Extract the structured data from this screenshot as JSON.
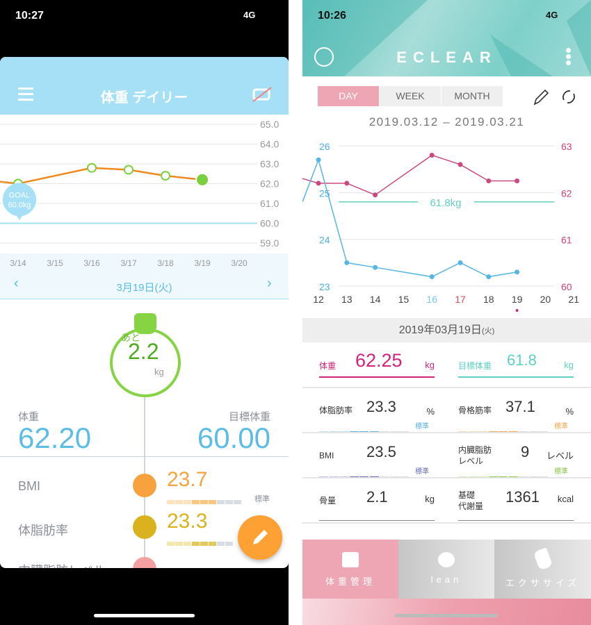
{
  "left_screen": {
    "status": {
      "time": "10:27",
      "network": "4G"
    },
    "header": {
      "title": "体重 デイリー",
      "menu_icon": "hamburger-icon",
      "sync_icon": "sync-disabled-icon"
    },
    "chart_data": {
      "type": "line",
      "x": [
        "3/14",
        "3/15",
        "3/16",
        "3/17",
        "3/18",
        "3/19",
        "3/20"
      ],
      "yticks": [
        "65.0",
        "64.0",
        "63.0",
        "62.0",
        "61.0",
        "60.0",
        "59.0"
      ],
      "ylim": [
        59,
        65
      ],
      "series": [
        {
          "points": [
            [
              "3/14",
              62.0
            ],
            [
              "3/16",
              62.8
            ],
            [
              "3/17",
              62.7
            ],
            [
              "3/18",
              62.4
            ],
            [
              "3/19",
              62.2
            ]
          ],
          "color": "#f0891e"
        }
      ],
      "goal": {
        "value": 60.0,
        "label": "GOAL",
        "value_label": "60.0kg",
        "color": "#a6e0f6"
      }
    },
    "date_nav": {
      "label": "3月19日(火)",
      "prev": "‹",
      "next": "›"
    },
    "remaining": {
      "prefix": "あと",
      "value": "2.2",
      "unit": "kg"
    },
    "weight": {
      "label": "体重",
      "value": "62.20"
    },
    "target": {
      "label": "目標体重",
      "value": "60.00"
    },
    "metrics": [
      {
        "label": "BMI",
        "value": "23.7",
        "status": "標準",
        "color": "#f7a23c"
      },
      {
        "label": "体脂肪率",
        "value": "23.3",
        "status": "",
        "color": "#d9b21d"
      },
      {
        "label": "内臓脂肪レベル",
        "value": "",
        "color": "#f4a0a0"
      }
    ],
    "fab_icon": "pencil-icon"
  },
  "right_screen": {
    "status": {
      "time": "10:26",
      "network": "4G"
    },
    "header": {
      "logo": "ECLEAR"
    },
    "tabs": [
      {
        "label": "DAY",
        "active": true
      },
      {
        "label": "WEEK"
      },
      {
        "label": "MONTH"
      }
    ],
    "date_range": "2019.03.12 – 2019.03.21",
    "chart_data": {
      "type": "line",
      "x": [
        "12",
        "13",
        "14",
        "15",
        "16",
        "17",
        "18",
        "19",
        "20",
        "21"
      ],
      "left_axis": {
        "ticks": [
          "26",
          "25",
          "24",
          "23"
        ],
        "range": [
          23,
          26
        ],
        "color": "#4aaee0"
      },
      "right_axis": {
        "ticks": [
          "63",
          "62",
          "61",
          "60"
        ],
        "range": [
          60,
          63
        ],
        "color": "#d0407a"
      },
      "series": [
        {
          "axis": "right",
          "color": "#c94a7e",
          "points": [
            [
              12,
              62.2
            ],
            [
              13,
              62.2
            ],
            [
              14,
              61.95
            ],
            [
              16,
              62.8
            ],
            [
              17,
              62.6
            ],
            [
              18,
              62.25
            ],
            [
              19,
              62.25
            ]
          ]
        },
        {
          "axis": "left",
          "color": "#55b6e3",
          "points": [
            [
              12,
              25.7
            ],
            [
              13,
              23.5
            ],
            [
              14,
              23.4
            ],
            [
              16,
              23.2
            ],
            [
              17,
              23.5
            ],
            [
              18,
              23.2
            ],
            [
              19,
              23.3
            ]
          ]
        }
      ],
      "target": {
        "value": 61.8,
        "label": "61.8kg",
        "color": "#5fcfc3"
      }
    },
    "date_header": {
      "date": "2019年03月19日",
      "weekday": "(火)"
    },
    "weight": {
      "label": "体重",
      "value": "62.25",
      "unit": "kg"
    },
    "target": {
      "label": "目標体重",
      "value": "61.8",
      "unit": "kg"
    },
    "cells": [
      {
        "label": "体脂肪率",
        "value": "23.3",
        "unit": "%",
        "status": "標準",
        "color": "#5ab4dc"
      },
      {
        "label": "骨格筋率",
        "value": "37.1",
        "unit": "%",
        "status": "標準",
        "color": "#f0a850"
      },
      {
        "label": "BMI",
        "value": "23.5",
        "unit": "",
        "status": "標準",
        "color": "#6a6fb5"
      },
      {
        "label": "内臓脂肪\nレベル",
        "value": "9",
        "unit": "レベル",
        "status": "標準",
        "color": "#8cc84b"
      },
      {
        "label": "骨量",
        "value": "2.1",
        "unit": "kg"
      },
      {
        "label": "基礎\n代謝量",
        "value": "1361",
        "unit": "kcal"
      }
    ],
    "bottom_nav": [
      {
        "label": "体重管理",
        "active": true
      },
      {
        "label": "lean"
      },
      {
        "label": "エクササイズ"
      }
    ]
  }
}
